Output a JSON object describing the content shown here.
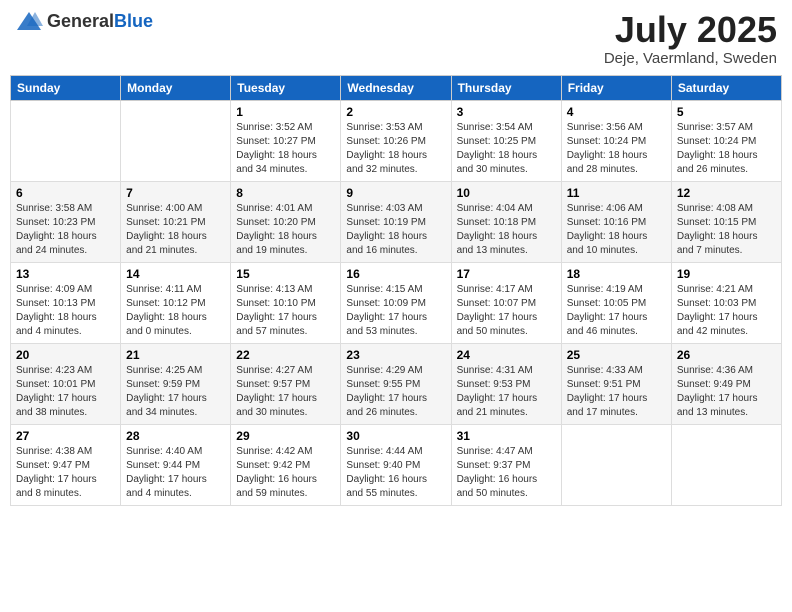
{
  "header": {
    "logo_general": "General",
    "logo_blue": "Blue",
    "month": "July 2025",
    "location": "Deje, Vaermland, Sweden"
  },
  "weekdays": [
    "Sunday",
    "Monday",
    "Tuesday",
    "Wednesday",
    "Thursday",
    "Friday",
    "Saturday"
  ],
  "weeks": [
    [
      {
        "day": "",
        "info": ""
      },
      {
        "day": "",
        "info": ""
      },
      {
        "day": "1",
        "info": "Sunrise: 3:52 AM\nSunset: 10:27 PM\nDaylight: 18 hours\nand 34 minutes."
      },
      {
        "day": "2",
        "info": "Sunrise: 3:53 AM\nSunset: 10:26 PM\nDaylight: 18 hours\nand 32 minutes."
      },
      {
        "day": "3",
        "info": "Sunrise: 3:54 AM\nSunset: 10:25 PM\nDaylight: 18 hours\nand 30 minutes."
      },
      {
        "day": "4",
        "info": "Sunrise: 3:56 AM\nSunset: 10:24 PM\nDaylight: 18 hours\nand 28 minutes."
      },
      {
        "day": "5",
        "info": "Sunrise: 3:57 AM\nSunset: 10:24 PM\nDaylight: 18 hours\nand 26 minutes."
      }
    ],
    [
      {
        "day": "6",
        "info": "Sunrise: 3:58 AM\nSunset: 10:23 PM\nDaylight: 18 hours\nand 24 minutes."
      },
      {
        "day": "7",
        "info": "Sunrise: 4:00 AM\nSunset: 10:21 PM\nDaylight: 18 hours\nand 21 minutes."
      },
      {
        "day": "8",
        "info": "Sunrise: 4:01 AM\nSunset: 10:20 PM\nDaylight: 18 hours\nand 19 minutes."
      },
      {
        "day": "9",
        "info": "Sunrise: 4:03 AM\nSunset: 10:19 PM\nDaylight: 18 hours\nand 16 minutes."
      },
      {
        "day": "10",
        "info": "Sunrise: 4:04 AM\nSunset: 10:18 PM\nDaylight: 18 hours\nand 13 minutes."
      },
      {
        "day": "11",
        "info": "Sunrise: 4:06 AM\nSunset: 10:16 PM\nDaylight: 18 hours\nand 10 minutes."
      },
      {
        "day": "12",
        "info": "Sunrise: 4:08 AM\nSunset: 10:15 PM\nDaylight: 18 hours\nand 7 minutes."
      }
    ],
    [
      {
        "day": "13",
        "info": "Sunrise: 4:09 AM\nSunset: 10:13 PM\nDaylight: 18 hours\nand 4 minutes."
      },
      {
        "day": "14",
        "info": "Sunrise: 4:11 AM\nSunset: 10:12 PM\nDaylight: 18 hours\nand 0 minutes."
      },
      {
        "day": "15",
        "info": "Sunrise: 4:13 AM\nSunset: 10:10 PM\nDaylight: 17 hours\nand 57 minutes."
      },
      {
        "day": "16",
        "info": "Sunrise: 4:15 AM\nSunset: 10:09 PM\nDaylight: 17 hours\nand 53 minutes."
      },
      {
        "day": "17",
        "info": "Sunrise: 4:17 AM\nSunset: 10:07 PM\nDaylight: 17 hours\nand 50 minutes."
      },
      {
        "day": "18",
        "info": "Sunrise: 4:19 AM\nSunset: 10:05 PM\nDaylight: 17 hours\nand 46 minutes."
      },
      {
        "day": "19",
        "info": "Sunrise: 4:21 AM\nSunset: 10:03 PM\nDaylight: 17 hours\nand 42 minutes."
      }
    ],
    [
      {
        "day": "20",
        "info": "Sunrise: 4:23 AM\nSunset: 10:01 PM\nDaylight: 17 hours\nand 38 minutes."
      },
      {
        "day": "21",
        "info": "Sunrise: 4:25 AM\nSunset: 9:59 PM\nDaylight: 17 hours\nand 34 minutes."
      },
      {
        "day": "22",
        "info": "Sunrise: 4:27 AM\nSunset: 9:57 PM\nDaylight: 17 hours\nand 30 minutes."
      },
      {
        "day": "23",
        "info": "Sunrise: 4:29 AM\nSunset: 9:55 PM\nDaylight: 17 hours\nand 26 minutes."
      },
      {
        "day": "24",
        "info": "Sunrise: 4:31 AM\nSunset: 9:53 PM\nDaylight: 17 hours\nand 21 minutes."
      },
      {
        "day": "25",
        "info": "Sunrise: 4:33 AM\nSunset: 9:51 PM\nDaylight: 17 hours\nand 17 minutes."
      },
      {
        "day": "26",
        "info": "Sunrise: 4:36 AM\nSunset: 9:49 PM\nDaylight: 17 hours\nand 13 minutes."
      }
    ],
    [
      {
        "day": "27",
        "info": "Sunrise: 4:38 AM\nSunset: 9:47 PM\nDaylight: 17 hours\nand 8 minutes."
      },
      {
        "day": "28",
        "info": "Sunrise: 4:40 AM\nSunset: 9:44 PM\nDaylight: 17 hours\nand 4 minutes."
      },
      {
        "day": "29",
        "info": "Sunrise: 4:42 AM\nSunset: 9:42 PM\nDaylight: 16 hours\nand 59 minutes."
      },
      {
        "day": "30",
        "info": "Sunrise: 4:44 AM\nSunset: 9:40 PM\nDaylight: 16 hours\nand 55 minutes."
      },
      {
        "day": "31",
        "info": "Sunrise: 4:47 AM\nSunset: 9:37 PM\nDaylight: 16 hours\nand 50 minutes."
      },
      {
        "day": "",
        "info": ""
      },
      {
        "day": "",
        "info": ""
      }
    ]
  ]
}
